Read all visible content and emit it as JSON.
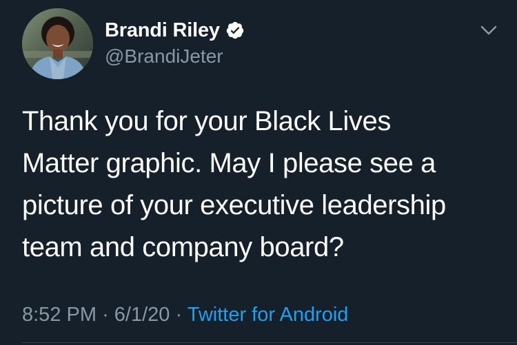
{
  "tweet": {
    "author": {
      "display_name": "Brandi Riley",
      "handle": "@BrandiJeter",
      "verified": true
    },
    "text": "Thank you for your Black Lives\nMatter graphic. May I please see a\npicture of your executive leadership\nteam and company board?",
    "time": "8:52 PM",
    "date": "6/1/20",
    "separator": "·",
    "source": "Twitter for Android"
  },
  "icons": {
    "verified": "verified-badge-icon",
    "caret": "chevron-down-icon"
  },
  "colors": {
    "background": "#15202b",
    "text": "#ffffff",
    "secondary_text": "#8899a6",
    "link": "#1da1f2"
  }
}
